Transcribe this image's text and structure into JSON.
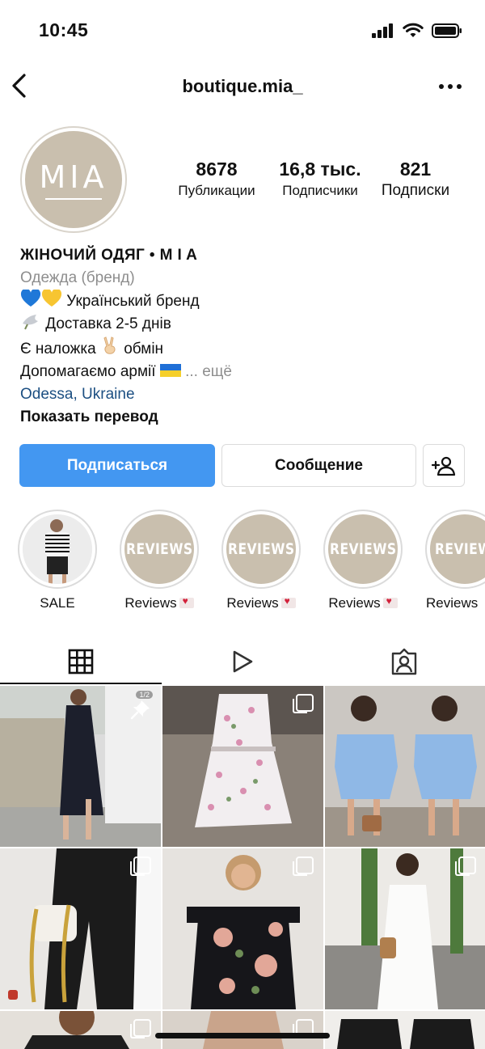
{
  "status_bar": {
    "time": "10:45"
  },
  "header": {
    "username": "boutique.mia_"
  },
  "profile": {
    "avatar_logo": "MIA",
    "stats": [
      {
        "value": "8678",
        "label": "Публикации"
      },
      {
        "value": "16,8 тыс.",
        "label": "Подписчики"
      },
      {
        "value": "821",
        "label": "Подписки"
      }
    ],
    "bio": {
      "name": "ЖІНОЧИЙ ОДЯГ • M I A",
      "category": "Одежда (бренд)",
      "line1": "Український бренд",
      "line2": "Доставка 2-5 днів",
      "line3a": "Є наложка",
      "line3b": "обмін",
      "line4": "Допомагаємо армії",
      "more": "... ещё",
      "location": "Odessa, Ukraine",
      "translate": "Показать перевод"
    }
  },
  "actions": {
    "follow": "Подписаться",
    "message": "Сообщение"
  },
  "highlights": [
    {
      "label": "SALE"
    },
    {
      "label": "Reviews",
      "cover": "REVIEWS"
    },
    {
      "label": "Reviews",
      "cover": "REVIEWS"
    },
    {
      "label": "Reviews",
      "cover": "REVIEWS"
    },
    {
      "label": "Reviews",
      "cover": "REVIEW"
    }
  ],
  "grid_pinned_count": "1/2",
  "colors": {
    "follow_button": "#4397f1",
    "brand_beige": "#c9bfae",
    "location_link": "#1c4f82"
  }
}
